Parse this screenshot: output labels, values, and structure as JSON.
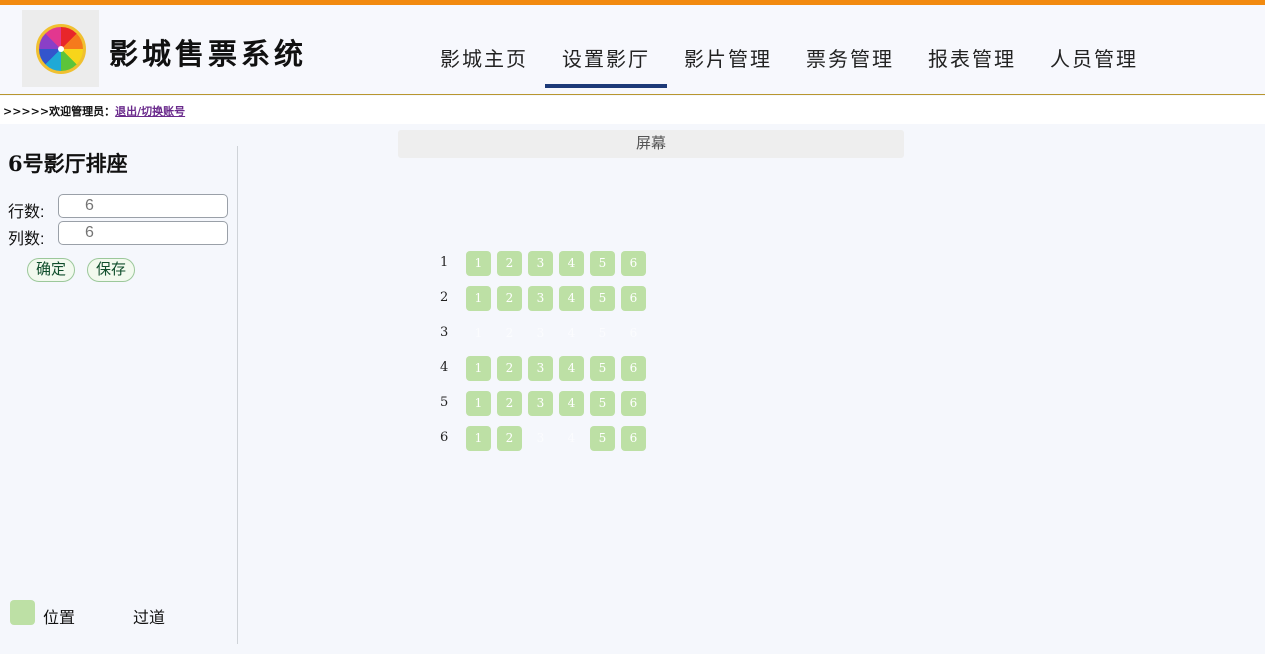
{
  "app": {
    "title": "影城售票系统"
  },
  "nav": [
    {
      "label": "影城主页",
      "active": false
    },
    {
      "label": "设置影厅",
      "active": true
    },
    {
      "label": "影片管理",
      "active": false
    },
    {
      "label": "票务管理",
      "active": false
    },
    {
      "label": "报表管理",
      "active": false
    },
    {
      "label": "人员管理",
      "active": false
    }
  ],
  "welcome": {
    "prefix": ">>>>>欢迎管理员：",
    "link": "退出/切换账号"
  },
  "sidebar": {
    "hall_title": "6号影厅排座",
    "rows_label": "行数:",
    "rows_value": "6",
    "cols_label": "列数:",
    "cols_value": "6",
    "confirm_label": "确定",
    "save_label": "保存"
  },
  "legend": {
    "seat_label": "位置",
    "aisle_label": "过道"
  },
  "screen_label": "屏幕",
  "seat_map": [
    {
      "row": "1",
      "seats": [
        {
          "n": "1",
          "on": true
        },
        {
          "n": "2",
          "on": true
        },
        {
          "n": "3",
          "on": true
        },
        {
          "n": "4",
          "on": true
        },
        {
          "n": "5",
          "on": true
        },
        {
          "n": "6",
          "on": true
        }
      ]
    },
    {
      "row": "2",
      "seats": [
        {
          "n": "1",
          "on": true
        },
        {
          "n": "2",
          "on": true
        },
        {
          "n": "3",
          "on": true
        },
        {
          "n": "4",
          "on": true
        },
        {
          "n": "5",
          "on": true
        },
        {
          "n": "6",
          "on": true
        }
      ]
    },
    {
      "row": "3",
      "seats": [
        {
          "n": "1",
          "on": false
        },
        {
          "n": "2",
          "on": false
        },
        {
          "n": "3",
          "on": false
        },
        {
          "n": "4",
          "on": false
        },
        {
          "n": "5",
          "on": false
        },
        {
          "n": "6",
          "on": false
        }
      ]
    },
    {
      "row": "4",
      "seats": [
        {
          "n": "1",
          "on": true
        },
        {
          "n": "2",
          "on": true
        },
        {
          "n": "3",
          "on": true
        },
        {
          "n": "4",
          "on": true
        },
        {
          "n": "5",
          "on": true
        },
        {
          "n": "6",
          "on": true
        }
      ]
    },
    {
      "row": "5",
      "seats": [
        {
          "n": "1",
          "on": true
        },
        {
          "n": "2",
          "on": true
        },
        {
          "n": "3",
          "on": true
        },
        {
          "n": "4",
          "on": true
        },
        {
          "n": "5",
          "on": true
        },
        {
          "n": "6",
          "on": true
        }
      ]
    },
    {
      "row": "6",
      "seats": [
        {
          "n": "1",
          "on": true
        },
        {
          "n": "2",
          "on": true
        },
        {
          "n": "3",
          "on": false
        },
        {
          "n": "4",
          "on": false
        },
        {
          "n": "5",
          "on": true
        },
        {
          "n": "6",
          "on": true
        }
      ]
    }
  ],
  "colors": {
    "accent": "#f28a10",
    "nav_active": "#1d3a78",
    "seat": "#bde0a5"
  }
}
